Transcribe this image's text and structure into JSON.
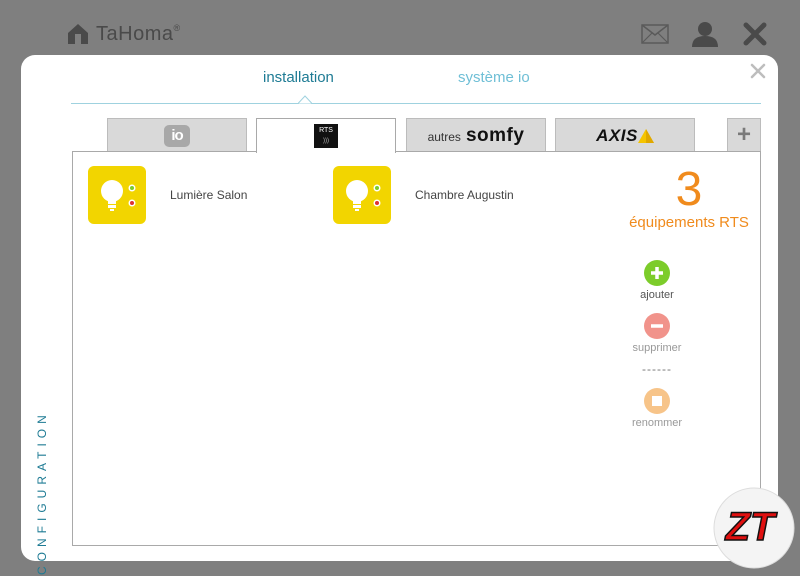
{
  "app": {
    "name": "TaHoma",
    "trademark": "®"
  },
  "header_icons": [
    "mail-icon",
    "user-icon",
    "close-icon"
  ],
  "modal": {
    "nav_tabs": [
      {
        "label": "installation",
        "active": true
      },
      {
        "label": "système io",
        "active": false
      }
    ],
    "category_tabs": [
      {
        "name": "io",
        "logo_text": "io",
        "active": false
      },
      {
        "name": "RTS",
        "logo_text": "RTS",
        "active": true
      },
      {
        "name": "somfy",
        "prefix": "autres",
        "logo_text": "somfy",
        "active": false
      },
      {
        "name": "AXIS",
        "logo_text": "AXIS",
        "active": false
      }
    ],
    "add_tab_label": "+",
    "devices": [
      {
        "label": "Lumière Salon",
        "icon": "light-bulb-icon"
      },
      {
        "label": "Chambre Augustin",
        "icon": "light-bulb-icon"
      }
    ],
    "summary": {
      "count": "3",
      "label": "équipements RTS"
    },
    "actions": {
      "add": "ajouter",
      "delete": "supprimer",
      "separator": "------",
      "rename": "renommer"
    },
    "side_label": "CONFIGURATION"
  },
  "colors": {
    "accent_teal": "#1e7b94",
    "accent_light": "#6fbfd6",
    "orange": "#f08b1d",
    "device_yellow": "#f2d500",
    "green": "#7ccc2a"
  },
  "watermark": {
    "text": "ZT"
  }
}
